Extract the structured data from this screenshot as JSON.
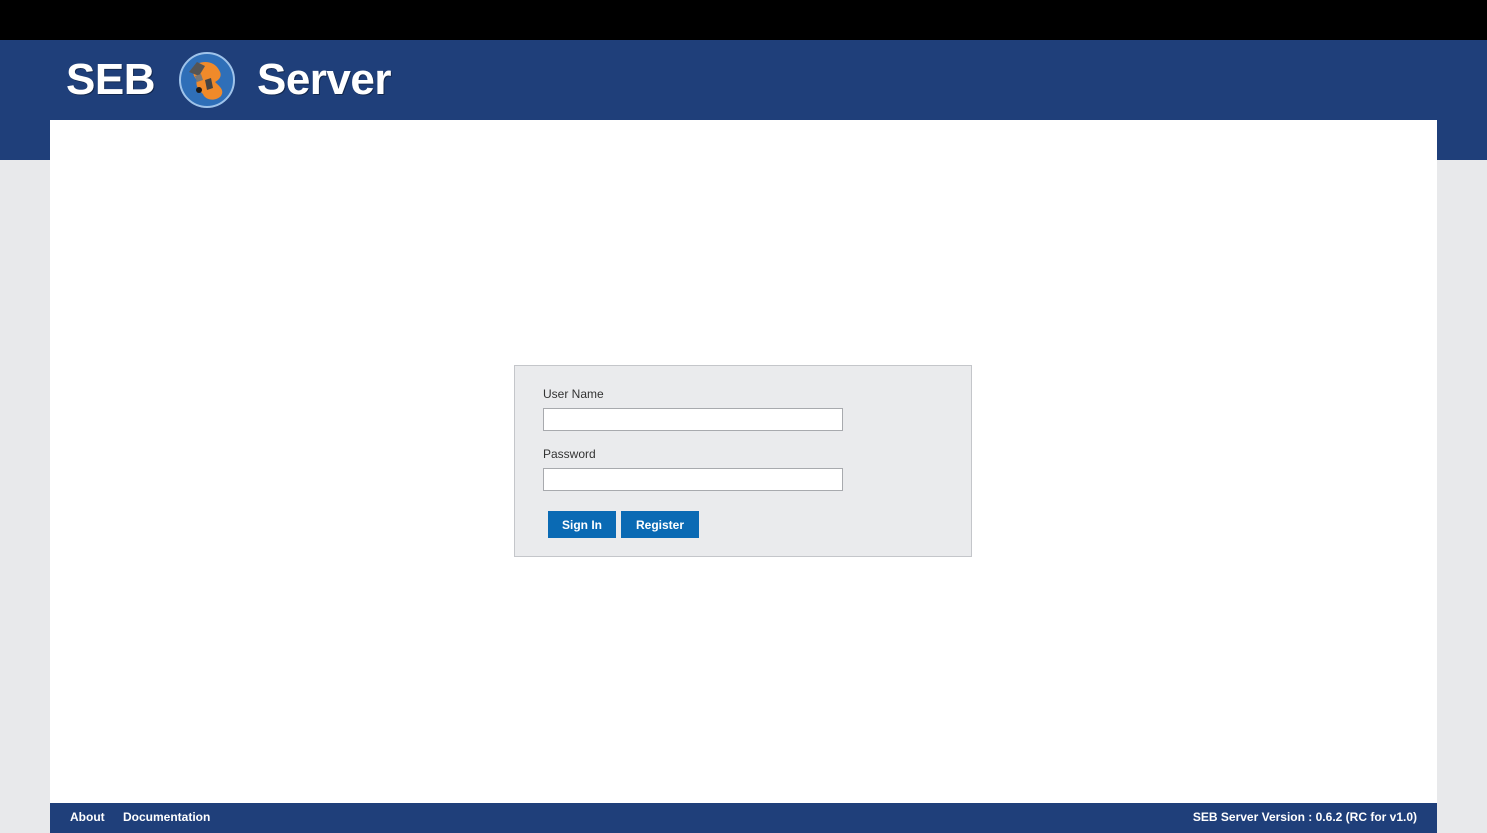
{
  "app": {
    "logo_left": "SEB",
    "logo_right": "Server",
    "colors": {
      "header": "#1f3f7a",
      "button": "#0a6ab4",
      "panel": "#eaebed"
    }
  },
  "login": {
    "username_label": "User Name",
    "username_value": "",
    "password_label": "Password",
    "password_value": "",
    "sign_in_label": "Sign In",
    "register_label": "Register"
  },
  "footer": {
    "about": "About",
    "documentation": "Documentation",
    "version": "SEB Server Version : 0.6.2 (RC for v1.0)"
  }
}
